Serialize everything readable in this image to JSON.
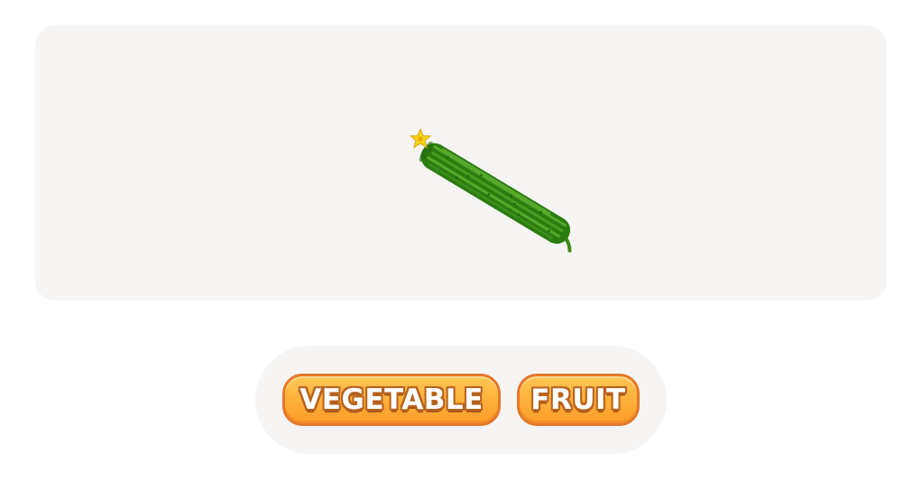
{
  "game": {
    "prompt_image": {
      "subject": "cucumber",
      "colors": {
        "panel_background": "#f6f5f4",
        "cucumber_skin": "#2f8a12",
        "cucumber_stripe": "#56a82a",
        "flower": "#f5d417"
      }
    },
    "answers": {
      "vegetable_label": "VEGETABLE",
      "fruit_label": "FRUIT"
    },
    "colors": {
      "button_fill": "#ffb13b",
      "button_border": "#e5782a",
      "button_text": "#ffffff",
      "bar_background": "#f6f5f4"
    }
  }
}
